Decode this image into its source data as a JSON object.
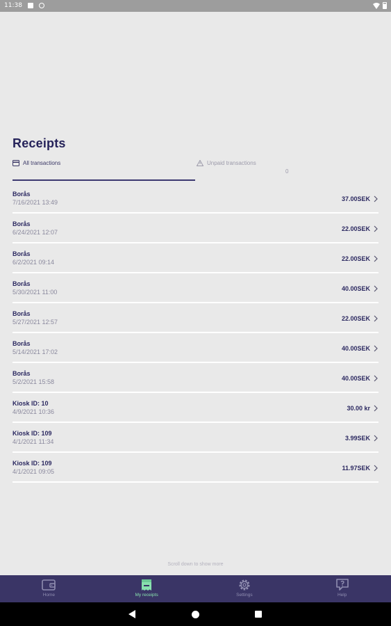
{
  "status_bar": {
    "time": "11:38"
  },
  "page": {
    "title": "Receipts"
  },
  "tabs": [
    {
      "label": "All transactions"
    },
    {
      "label": "Unpaid transactions",
      "count": "0"
    }
  ],
  "receipts": [
    {
      "name": "Borås",
      "date": "7/16/2021 13:49",
      "amount": "37.00SEK"
    },
    {
      "name": "Borås",
      "date": "6/24/2021 12:07",
      "amount": "22.00SEK"
    },
    {
      "name": "Borås",
      "date": "6/2/2021 09:14",
      "amount": "22.00SEK"
    },
    {
      "name": "Borås",
      "date": "5/30/2021 11:00",
      "amount": "40.00SEK"
    },
    {
      "name": "Borås",
      "date": "5/27/2021 12:57",
      "amount": "22.00SEK"
    },
    {
      "name": "Borås",
      "date": "5/14/2021 17:02",
      "amount": "40.00SEK"
    },
    {
      "name": "Borås",
      "date": "5/2/2021 15:58",
      "amount": "40.00SEK"
    },
    {
      "name": "Kiosk ID: 10",
      "date": "4/9/2021 10:36",
      "amount": "30.00 kr"
    },
    {
      "name": "Kiosk ID: 109",
      "date": "4/1/2021 11:34",
      "amount": "3.99SEK"
    },
    {
      "name": "Kiosk ID: 109",
      "date": "4/1/2021 09:05",
      "amount": "11.97SEK"
    }
  ],
  "scroll_hint": "Scroll down to show more",
  "bottom_nav": [
    {
      "label": "Home",
      "icon": "wallet-icon"
    },
    {
      "label": "My receipts",
      "icon": "receipt-icon",
      "active": true
    },
    {
      "label": "Settings",
      "icon": "gear-icon"
    },
    {
      "label": "Help",
      "icon": "help-chat-icon"
    }
  ],
  "colors": {
    "background": "#e9e9e9",
    "primary": "#2b2860",
    "nav_bg": "#3a3566",
    "nav_active": "#88e0ae"
  }
}
